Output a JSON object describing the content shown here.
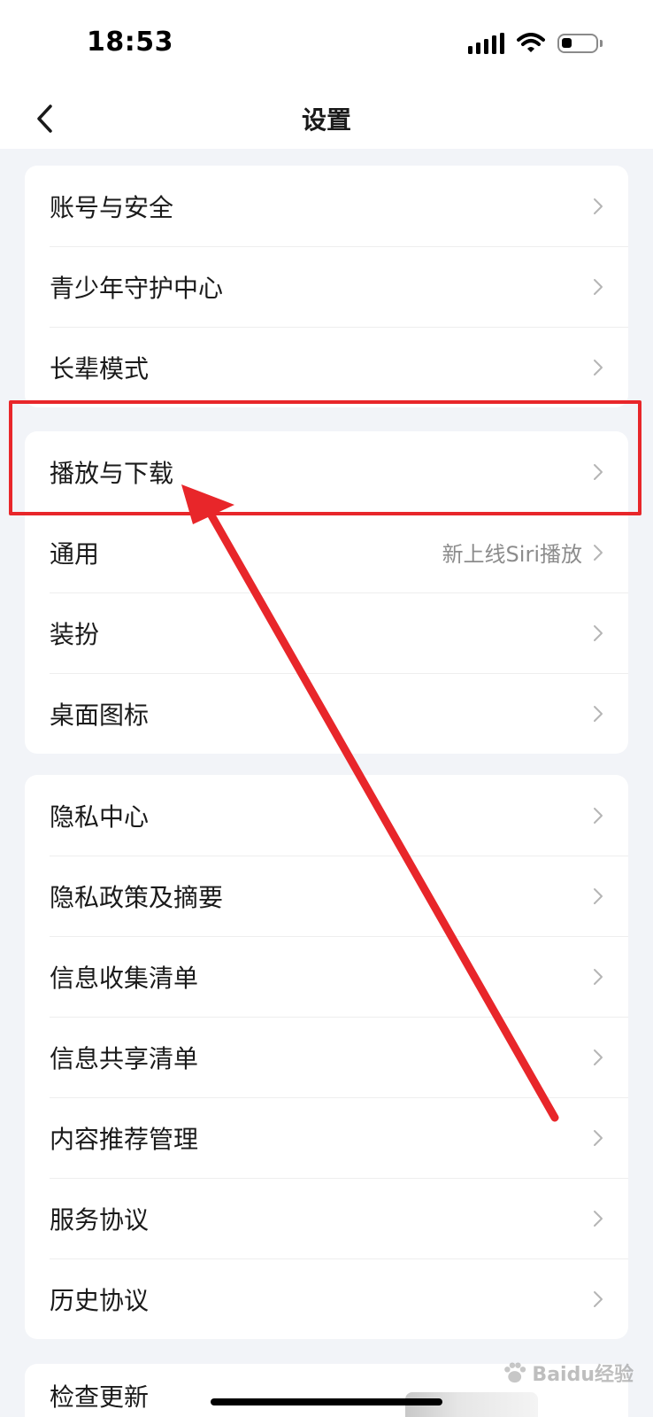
{
  "status_bar": {
    "time": "18:53"
  },
  "nav": {
    "title": "设置"
  },
  "groups": [
    {
      "items": [
        {
          "label": "账号与安全",
          "value": ""
        },
        {
          "label": "青少年守护中心",
          "value": ""
        },
        {
          "label": "长辈模式",
          "value": ""
        }
      ]
    },
    {
      "items": [
        {
          "label": "播放与下载",
          "value": ""
        },
        {
          "label": "通用",
          "value": "新上线Siri播放"
        },
        {
          "label": "装扮",
          "value": ""
        },
        {
          "label": "桌面图标",
          "value": ""
        }
      ]
    },
    {
      "items": [
        {
          "label": "隐私中心",
          "value": ""
        },
        {
          "label": "隐私政策及摘要",
          "value": ""
        },
        {
          "label": "信息收集清单",
          "value": ""
        },
        {
          "label": "信息共享清单",
          "value": ""
        },
        {
          "label": "内容推荐管理",
          "value": ""
        },
        {
          "label": "服务协议",
          "value": ""
        },
        {
          "label": "历史协议",
          "value": ""
        }
      ]
    },
    {
      "items": [
        {
          "label": "检查更新",
          "value": ""
        }
      ]
    }
  ],
  "watermark": {
    "text": "Baidu经验"
  },
  "colors": {
    "annotation": "#e8262a",
    "background": "#f2f4f8",
    "secondary_text": "#8c8c8c"
  }
}
